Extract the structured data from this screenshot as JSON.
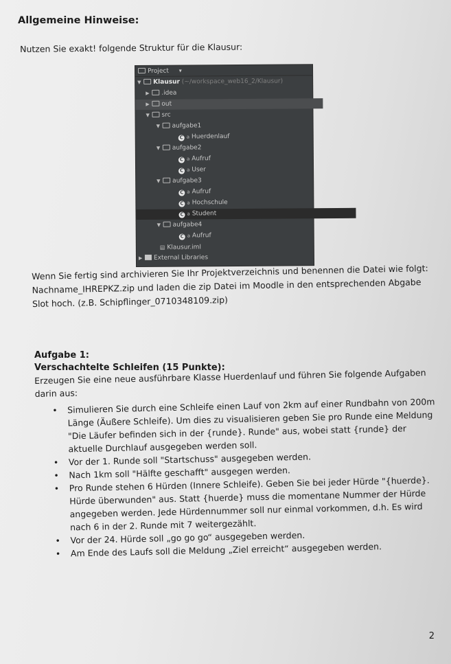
{
  "heading": "Allgemeine Hinweise:",
  "intro": "Nutzen Sie exakt! folgende Struktur für die Klausur:",
  "tree": {
    "header": "Project",
    "header_arrow": "▾",
    "root_name": "Klausur",
    "root_path": "(~/workspace_web16_2/Klausur)",
    "idea": ".idea",
    "out": "out",
    "src": "src",
    "aufgabe1": "aufgabe1",
    "hurdenlauf": "Huerdenlauf",
    "aufgabe2": "aufgabe2",
    "a2_aufruf": "Aufruf",
    "a2_user": "User",
    "aufgabe3": "aufgabe3",
    "a3_aufruf": "Aufruf",
    "a3_hochschule": "Hochschule",
    "a3_student": "Student",
    "aufgabe4": "aufgabe4",
    "a4_aufruf": "Aufruf",
    "iml": "Klausur.iml",
    "external": "External Libraries"
  },
  "para": [
    "Wenn Sie fertig sind archivieren Sie Ihr Projektverzeichnis und benennen die Datei wie folgt:",
    "Nachname_IHREPKZ.zip und laden die zip Datei im Moodle in den entsprechenden Abgabe",
    "Slot hoch. (z.B. Schipflinger_0710348109.zip)"
  ],
  "task": {
    "title": "Aufgabe 1:",
    "subtitle": "Verschachtelte Schleifen (15 Punkte):",
    "intro": [
      "Erzeugen Sie eine neue ausführbare Klasse Huerdenlauf und führen Sie folgende Aufgaben",
      "darin aus:"
    ],
    "items": [
      [
        "Simulieren Sie durch eine Schleife einen Lauf von 2km auf einer Rundbahn von 200m",
        "Länge (Äußere Schleife). Um dies zu visualisieren geben Sie pro Runde eine Meldung",
        "\"Die Läufer befinden sich in der {runde}. Runde\" aus, wobei statt {runde} der",
        "aktuelle Durchlauf ausgegeben werden soll."
      ],
      [
        "Vor der 1. Runde soll \"Startschuss\" ausgegeben werden."
      ],
      [
        "Nach 1km soll \"Hälfte geschafft\" ausgegen werden."
      ],
      [
        "Pro Runde stehen 6 Hürden (Innere Schleife). Geben Sie bei jeder Hürde \"{huerde}.",
        "Hürde überwunden\" aus. Statt {huerde} muss die momentane Nummer der Hürde",
        "angegeben werden. Jede Hürdennummer soll nur einmal vorkommen, d.h. Es wird",
        "nach 6 in der 2. Runde mit 7 weitergezählt."
      ],
      [
        "Vor der 24. Hürde soll „go go go“ ausgegeben werden."
      ],
      [
        "Am Ende des Laufs soll die Meldung „Ziel erreicht“ ausgegeben werden."
      ]
    ]
  },
  "page_number": "2"
}
